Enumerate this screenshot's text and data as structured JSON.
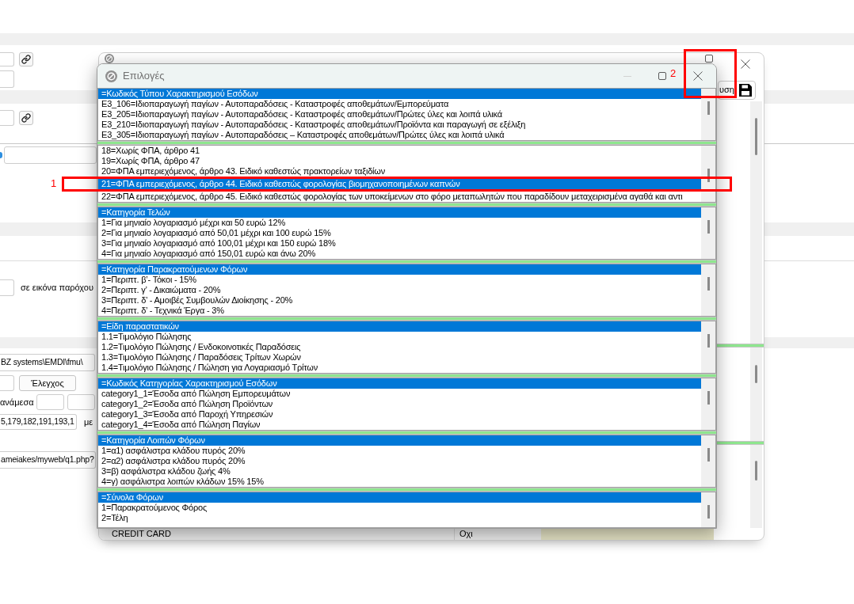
{
  "page": {
    "provider_label": "σε εικόνα παρόχου",
    "path_value": "BZ systems\\EMDI\\fmu\\",
    "check_button": "Έλεγχος",
    "between_label": "ανάμεσα",
    "codes_value": "5,179,182,191,193,1",
    "with_label": "με",
    "url_value": "ameiakes/myweb/q1.php?"
  },
  "back_window": {
    "toolbar_button": "υση",
    "table_row": [
      "CREDIT CARD",
      "Οχι"
    ]
  },
  "dialog": {
    "title": "Επιλογές",
    "minimize_disabled": true,
    "lists": [
      {
        "rows": [
          {
            "text": "=Κωδικός Τύπου Χαρακτηρισμού Εσόδων",
            "selected": true
          },
          {
            "text": "E3_106=Ιδιοπαραγωγή παγίων - Αυτοπαραδόσεις - Καταστροφές αποθεμάτων/Εμπορεύματα",
            "selected": false
          },
          {
            "text": "E3_205=Ιδιοπαραγωγή παγίων - Αυτοπαραδόσεις - Καταστροφές αποθεμάτων/Πρώτες ύλες και λοιπά υλικά",
            "selected": false
          },
          {
            "text": "E3_210=Ιδιοπαραγωγή παγίων - Αυτοπαραδόσεις - Καταστροφές αποθεμάτων/Προϊόντα και παραγωγή σε εξέλιξη",
            "selected": false
          },
          {
            "text": "E3_305=Ιδιοπαραγωγή παγίων - Αυτοπαραδόσεις – Καταστροφές αποθεμάτων/Πρώτες ύλες και λοιπά υλικά",
            "selected": false
          }
        ]
      },
      {
        "rows": [
          {
            "text": "18=Χωρίς ΦΠΑ, άρθρο 41",
            "selected": false
          },
          {
            "text": "19=Χωρίς ΦΠΑ, άρθρο 47",
            "selected": false
          },
          {
            "text": "20=ΦΠΑ εμπεριεχόμενος, άρθρο 43. Ειδικό καθεστώς πρακτορείων ταξιδίων",
            "selected": false
          },
          {
            "text": "21=ΦΠΑ εμπεριεχόμενος, άρθρο 44. Ειδικό καθεστώς φορολογίας βιομηχανοποιημένων καπνών",
            "selected": true
          },
          {
            "text": "22=ΦΠΑ εμπεριεχόμενος, άρθρο 45. Ειδικό καθεστώς φορολογίας των υποκείμενων στο φόρο μεταπωλητών που παραδίδουν μεταχειρισμένα αγαθά και αντι",
            "selected": false
          }
        ]
      },
      {
        "rows": [
          {
            "text": "=Κατηγορία Τελών",
            "selected": true
          },
          {
            "text": "1=Για μηνιαίο λογαριασμό μέχρι και 50 ευρώ 12%",
            "selected": false
          },
          {
            "text": "2=Για μηνιαίο λογαριασμό από 50,01 μέχρι και 100 ευρώ 15%",
            "selected": false
          },
          {
            "text": "3=Για μηνιαίο λογαριασμό από 100,01 μέχρι και 150 ευρώ 18%",
            "selected": false
          },
          {
            "text": "4=Για μηνιαίο λογαριασμό από 150,01 ευρώ και άνω 20%",
            "selected": false
          }
        ]
      },
      {
        "rows": [
          {
            "text": "=Κατηγορία Παρακρατούμενων Φόρων",
            "selected": true
          },
          {
            "text": "1=Περιπτ. β’- Τόκοι - 15%",
            "selected": false
          },
          {
            "text": "2=Περιπτ. γ’ - Δικαιώματα - 20%",
            "selected": false
          },
          {
            "text": "3=Περιπτ. δ’ - Αμοιβές Συμβουλών Διοίκησης - 20%",
            "selected": false
          },
          {
            "text": "4=Περιπτ. δ’ - Τεχνικά Έργα - 3%",
            "selected": false
          }
        ]
      },
      {
        "rows": [
          {
            "text": "=Είδη παραστατικών",
            "selected": true
          },
          {
            "text": "1.1=Τιμολόγιο Πώλησης",
            "selected": false
          },
          {
            "text": "1.2=Τιμολόγιο Πώλησης / Ενδοκοινοτικές Παραδόσεις",
            "selected": false
          },
          {
            "text": "1.3=Τιμολόγιο Πώλησης / Παραδόσεις Τρίτων Χωρών",
            "selected": false
          },
          {
            "text": "1.4=Τιμολόγιο Πώλησης / Πώληση για Λογαριασμό Τρίτων",
            "selected": false
          }
        ]
      },
      {
        "rows": [
          {
            "text": "=Κωδικός Κατηγορίας Χαρακτηρισμού Εσόδων",
            "selected": true
          },
          {
            "text": "category1_1=Έσοδα από Πώληση Εμπορευμάτων",
            "selected": false
          },
          {
            "text": "category1_2=Έσοδα από Πώληση Προϊόντων",
            "selected": false
          },
          {
            "text": "category1_3=Έσοδα από Παροχή Υπηρεσιών",
            "selected": false
          },
          {
            "text": "category1_4=Έσοδα από Πώληση Παγίων",
            "selected": false
          }
        ]
      },
      {
        "rows": [
          {
            "text": "=Κατηγορία Λοιπών Φόρων",
            "selected": true
          },
          {
            "text": "1=α1) ασφάλιστρα κλάδου πυρός 20%",
            "selected": false
          },
          {
            "text": "2=α2) ασφάλιστρα κλάδου πυρός 20%",
            "selected": false
          },
          {
            "text": "3=β) ασφάλιστρα κλάδου ζωής 4%",
            "selected": false
          },
          {
            "text": "4=γ) ασφάλιστρα λοιπών κλάδων 15% 15%",
            "selected": false
          }
        ]
      },
      {
        "rows": [
          {
            "text": "=Σύνολα Φόρων",
            "selected": true
          },
          {
            "text": "1=Παρακρατούμενος Φόρος",
            "selected": false
          },
          {
            "text": "2=Τέλη",
            "selected": false
          }
        ]
      }
    ]
  },
  "annotations": [
    {
      "label": "1"
    },
    {
      "label": "2"
    }
  ]
}
